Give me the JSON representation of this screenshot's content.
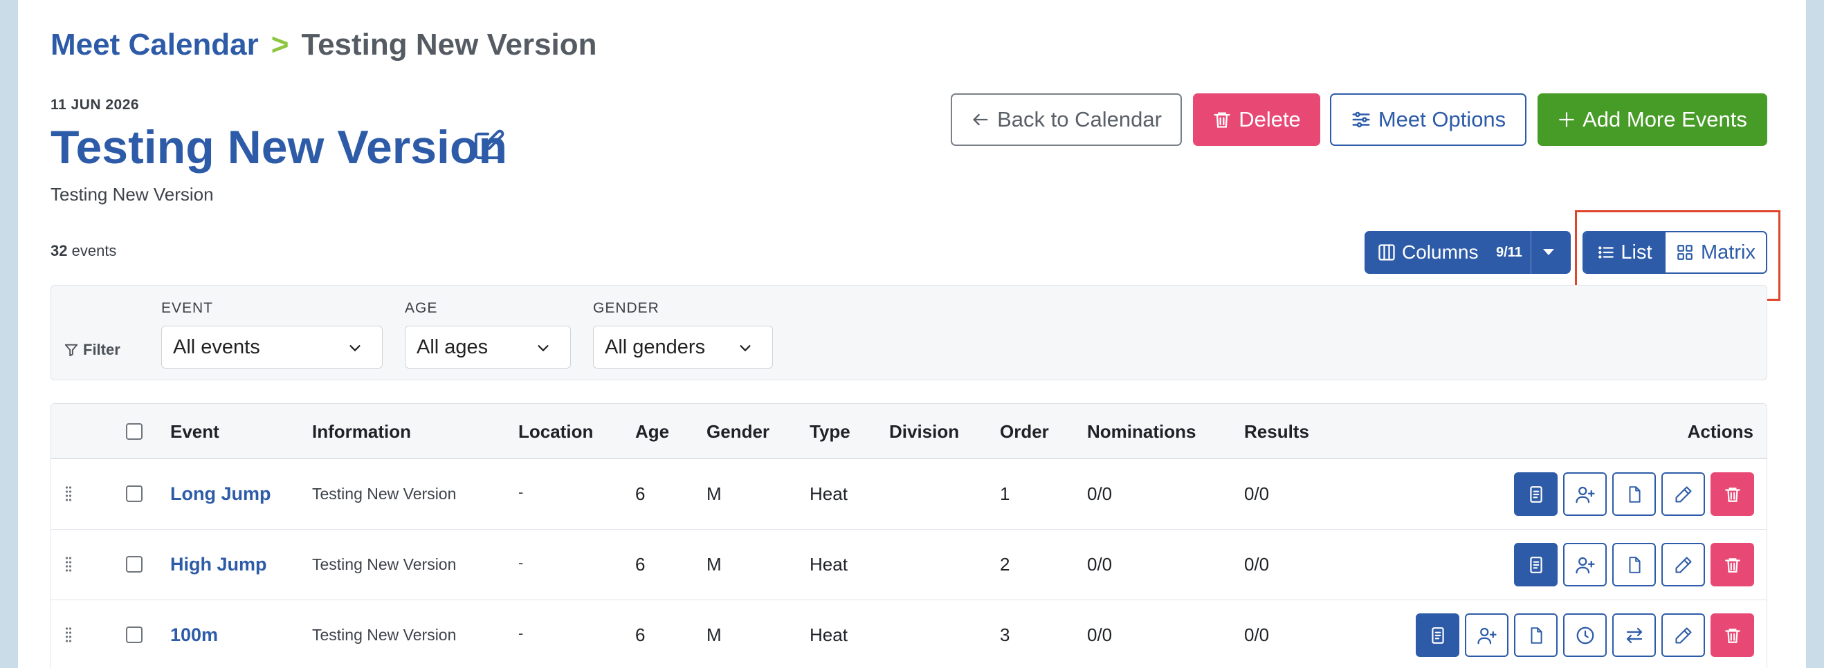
{
  "breadcrumb": {
    "parent": "Meet Calendar",
    "separator": ">",
    "current": "Testing New Version"
  },
  "meet": {
    "date": "11 JUN 2026",
    "title": "Testing New Version",
    "subtitle": "Testing New Version"
  },
  "buttons": {
    "back": "Back to Calendar",
    "delete": "Delete",
    "options": "Meet Options",
    "add": "Add More Events"
  },
  "summary": {
    "count": "32",
    "count_label": "events"
  },
  "columns": {
    "label": "Columns",
    "badge": "9/11"
  },
  "view_toggle": {
    "list": "List",
    "matrix": "Matrix",
    "active": "list"
  },
  "filters": {
    "label": "Filter",
    "event": {
      "caption": "EVENT",
      "value": "All events"
    },
    "age": {
      "caption": "AGE",
      "value": "All ages"
    },
    "gender": {
      "caption": "GENDER",
      "value": "All genders"
    }
  },
  "table": {
    "headers": {
      "event": "Event",
      "information": "Information",
      "location": "Location",
      "age": "Age",
      "gender": "Gender",
      "type": "Type",
      "division": "Division",
      "order": "Order",
      "nominations": "Nominations",
      "results": "Results",
      "actions": "Actions"
    },
    "rows": [
      {
        "event": "Long Jump",
        "information": "Testing New Version",
        "location": "-",
        "age": "6",
        "gender": "M",
        "type": "Heat",
        "division": "",
        "order": "1",
        "nominations": "0/0",
        "results": "0/0"
      },
      {
        "event": "High Jump",
        "information": "Testing New Version",
        "location": "-",
        "age": "6",
        "gender": "M",
        "type": "Heat",
        "division": "",
        "order": "2",
        "nominations": "0/0",
        "results": "0/0"
      },
      {
        "event": "100m",
        "information": "Testing New Version",
        "location": "-",
        "age": "6",
        "gender": "M",
        "type": "Heat",
        "division": "",
        "order": "3",
        "nominations": "0/0",
        "results": "0/0"
      }
    ]
  },
  "colors": {
    "primary": "#2d5ba8",
    "danger": "#e84874",
    "success": "#479b27",
    "accent": "#8cc63f",
    "highlight": "#e0452b"
  }
}
